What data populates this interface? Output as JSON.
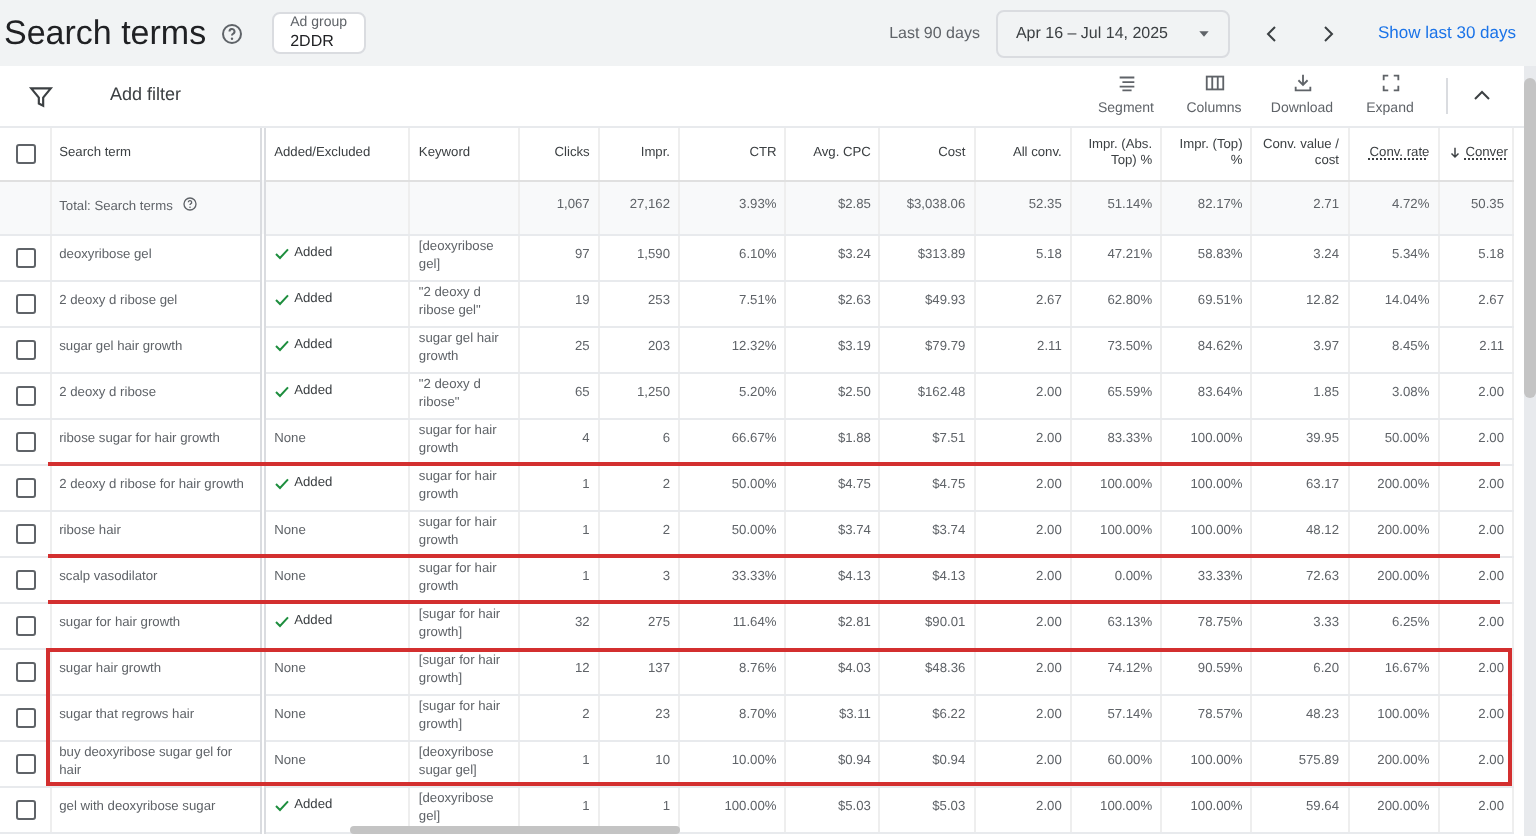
{
  "header": {
    "title": "Search terms",
    "ad_group": {
      "label": "Ad group",
      "value": "2DDR"
    },
    "range_label": "Last 90 days",
    "date_range": "Apr 16 – Jul 14, 2025",
    "show_link": "Show last 30 days"
  },
  "toolbar": {
    "add_filter": "Add filter",
    "actions": [
      {
        "kind": "segment",
        "label": "Segment"
      },
      {
        "kind": "columns",
        "label": "Columns"
      },
      {
        "kind": "download",
        "label": "Download"
      },
      {
        "kind": "expand",
        "label": "Expand"
      }
    ]
  },
  "table": {
    "all_checked": false,
    "columns": [
      {
        "label": "Search term",
        "sorted": false
      },
      {
        "label": "Added/Excluded",
        "sorted": false
      },
      {
        "label": "Keyword",
        "sorted": false
      },
      {
        "label": "Clicks",
        "sorted": false
      },
      {
        "label": "Impr.",
        "sorted": false
      },
      {
        "label": "CTR",
        "sorted": false
      },
      {
        "label": "Avg. CPC",
        "sorted": false
      },
      {
        "label": "Cost",
        "sorted": false
      },
      {
        "label": "All conv.",
        "sorted": false
      },
      {
        "label": "Impr. (Abs. Top) %",
        "sorted": false
      },
      {
        "label": "Impr. (Top) %",
        "sorted": false
      },
      {
        "label": "Conv. value / cost",
        "sorted": false
      },
      {
        "label": "Conv. rate",
        "sorted": false
      },
      {
        "label": "Conver",
        "sorted": true
      }
    ],
    "total": {
      "label": "Total: Search terms",
      "values": [
        "1,067",
        "27,162",
        "3.93%",
        "$2.85",
        "$3,038.06",
        "52.35",
        "51.14%",
        "82.17%",
        "2.71",
        "4.72%",
        "50.35"
      ]
    },
    "rows": [
      {
        "term": "deoxyribose gel",
        "checked": false,
        "status": "Added",
        "added": true,
        "keyword": "[deoxyribose gel]",
        "values": [
          "97",
          "1,590",
          "6.10%",
          "$3.24",
          "$313.89",
          "5.18",
          "47.21%",
          "58.83%",
          "3.24",
          "5.34%",
          "5.18"
        ],
        "underline": false,
        "boxed": false
      },
      {
        "term": "2 deoxy d ribose gel",
        "checked": false,
        "status": "Added",
        "added": true,
        "keyword": "\"2 deoxy d ribose gel\"",
        "values": [
          "19",
          "253",
          "7.51%",
          "$2.63",
          "$49.93",
          "2.67",
          "62.80%",
          "69.51%",
          "12.82",
          "14.04%",
          "2.67"
        ],
        "underline": false,
        "boxed": false
      },
      {
        "term": "sugar gel hair growth",
        "checked": false,
        "status": "Added",
        "added": true,
        "keyword": "sugar gel hair growth",
        "values": [
          "25",
          "203",
          "12.32%",
          "$3.19",
          "$79.79",
          "2.11",
          "73.50%",
          "84.62%",
          "3.97",
          "8.45%",
          "2.11"
        ],
        "underline": false,
        "boxed": false
      },
      {
        "term": "2 deoxy d ribose",
        "checked": false,
        "status": "Added",
        "added": true,
        "keyword": "\"2 deoxy d ribose\"",
        "values": [
          "65",
          "1,250",
          "5.20%",
          "$2.50",
          "$162.48",
          "2.00",
          "65.59%",
          "83.64%",
          "1.85",
          "3.08%",
          "2.00"
        ],
        "underline": false,
        "boxed": false
      },
      {
        "term": "ribose sugar for hair growth",
        "checked": false,
        "status": "None",
        "added": false,
        "keyword": "sugar for hair growth",
        "values": [
          "4",
          "6",
          "66.67%",
          "$1.88",
          "$7.51",
          "2.00",
          "83.33%",
          "100.00%",
          "39.95",
          "50.00%",
          "2.00"
        ],
        "underline": true,
        "boxed": false
      },
      {
        "term": "2 deoxy d ribose for hair growth",
        "checked": false,
        "status": "Added",
        "added": true,
        "keyword": "sugar for hair growth",
        "values": [
          "1",
          "2",
          "50.00%",
          "$4.75",
          "$4.75",
          "2.00",
          "100.00%",
          "100.00%",
          "63.17",
          "200.00%",
          "2.00"
        ],
        "underline": false,
        "boxed": false
      },
      {
        "term": "ribose hair",
        "checked": false,
        "status": "None",
        "added": false,
        "keyword": "sugar for hair growth",
        "values": [
          "1",
          "2",
          "50.00%",
          "$3.74",
          "$3.74",
          "2.00",
          "100.00%",
          "100.00%",
          "48.12",
          "200.00%",
          "2.00"
        ],
        "underline": true,
        "boxed": false
      },
      {
        "term": "scalp vasodilator",
        "checked": false,
        "status": "None",
        "added": false,
        "keyword": "sugar for hair growth",
        "values": [
          "1",
          "3",
          "33.33%",
          "$4.13",
          "$4.13",
          "2.00",
          "0.00%",
          "33.33%",
          "72.63",
          "200.00%",
          "2.00"
        ],
        "underline": true,
        "boxed": false
      },
      {
        "term": "sugar for hair growth",
        "checked": false,
        "status": "Added",
        "added": true,
        "keyword": "[sugar for hair growth]",
        "values": [
          "32",
          "275",
          "11.64%",
          "$2.81",
          "$90.01",
          "2.00",
          "63.13%",
          "78.75%",
          "3.33",
          "6.25%",
          "2.00"
        ],
        "underline": false,
        "boxed": false
      },
      {
        "term": "sugar hair growth",
        "checked": false,
        "status": "None",
        "added": false,
        "keyword": "[sugar for hair growth]",
        "values": [
          "12",
          "137",
          "8.76%",
          "$4.03",
          "$48.36",
          "2.00",
          "74.12%",
          "90.59%",
          "6.20",
          "16.67%",
          "2.00"
        ],
        "underline": false,
        "boxed": true
      },
      {
        "term": "sugar that regrows hair",
        "checked": false,
        "status": "None",
        "added": false,
        "keyword": "[sugar for hair growth]",
        "values": [
          "2",
          "23",
          "8.70%",
          "$3.11",
          "$6.22",
          "2.00",
          "57.14%",
          "78.57%",
          "48.23",
          "100.00%",
          "2.00"
        ],
        "underline": false,
        "boxed": true
      },
      {
        "term": "buy deoxyribose sugar gel for hair",
        "checked": false,
        "status": "None",
        "added": false,
        "keyword": "[deoxyribose sugar gel]",
        "values": [
          "1",
          "10",
          "10.00%",
          "$0.94",
          "$0.94",
          "2.00",
          "60.00%",
          "100.00%",
          "575.89",
          "200.00%",
          "2.00"
        ],
        "underline": false,
        "boxed": true
      },
      {
        "term": "gel with deoxyribose sugar",
        "checked": false,
        "status": "Added",
        "added": true,
        "keyword": "[deoxyribose gel]",
        "values": [
          "1",
          "1",
          "100.00%",
          "$5.03",
          "$5.03",
          "2.00",
          "100.00%",
          "100.00%",
          "59.64",
          "200.00%",
          "2.00"
        ],
        "underline": false,
        "boxed": false
      }
    ]
  }
}
